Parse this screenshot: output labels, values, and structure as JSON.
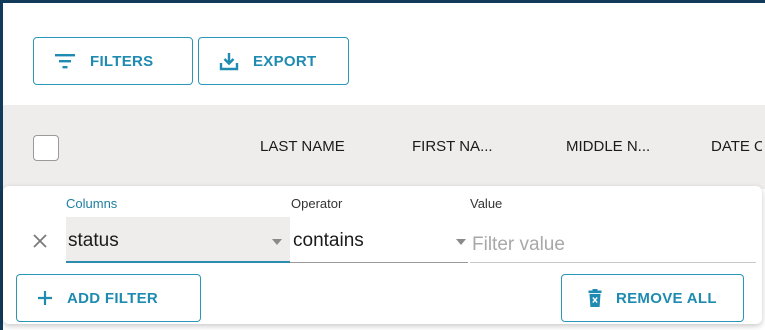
{
  "toolbar": {
    "filters_label": "FILTERS",
    "export_label": "EXPORT"
  },
  "grid": {
    "columns": [
      "LAST NAME",
      "FIRST NA...",
      "MIDDLE N...",
      "DATE O"
    ]
  },
  "filter_panel": {
    "columns_label": "Columns",
    "operator_label": "Operator",
    "value_label": "Value",
    "column_value": "status",
    "operator_value": "contains",
    "value_placeholder": "Filter value",
    "value_current": "",
    "add_filter_label": "ADD FILTER",
    "remove_all_label": "REMOVE ALL"
  },
  "icons": {
    "filters": "filter-lines-icon",
    "export": "download-tray-icon",
    "remove_row": "close-icon",
    "add": "plus-icon",
    "remove_all": "trash-icon",
    "dropdown": "caret-down-icon"
  },
  "colors": {
    "accent": "#1f8bb0",
    "frame": "#123a5a",
    "header_bg": "#eeedeb"
  }
}
